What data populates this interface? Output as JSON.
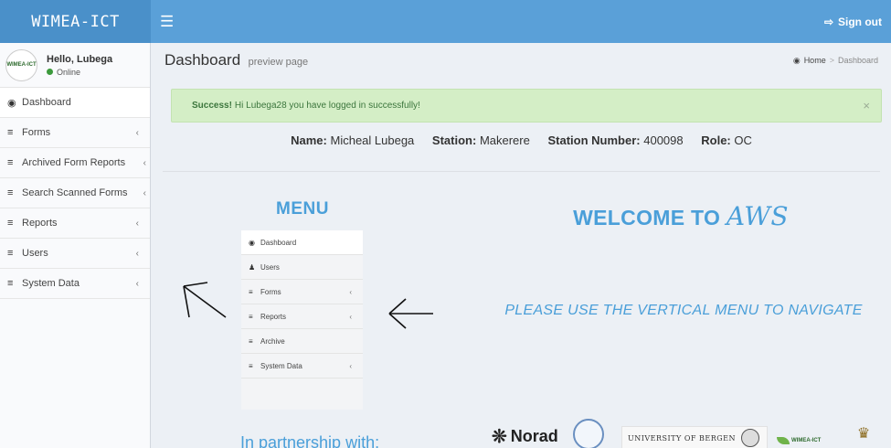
{
  "app": {
    "logo_text": "WIMEA-ICT"
  },
  "topbar": {
    "menu_icon": "hamburger-icon",
    "signout_label": "Sign out",
    "signout_icon": "sign-out-icon"
  },
  "user": {
    "greeting": "Hello, Lubega",
    "status": "Online",
    "avatar_text": "WIMEA-ICT"
  },
  "sidebar": {
    "items": [
      {
        "label": "Dashboard",
        "icon": "dashboard-icon",
        "has_submenu": false,
        "active": true
      },
      {
        "label": "Forms",
        "icon": "bars-icon",
        "has_submenu": true
      },
      {
        "label": "Archived Form Reports",
        "icon": "bars-icon",
        "has_submenu": true
      },
      {
        "label": "Search Scanned Forms",
        "icon": "bars-icon",
        "has_submenu": true
      },
      {
        "label": "Reports",
        "icon": "bars-icon",
        "has_submenu": true
      },
      {
        "label": "Users",
        "icon": "bars-icon",
        "has_submenu": true
      },
      {
        "label": "System Data",
        "icon": "bars-icon",
        "has_submenu": true
      }
    ]
  },
  "header": {
    "title": "Dashboard",
    "subtitle": "preview page",
    "breadcrumb": {
      "home": "Home",
      "separator": ">",
      "current": "Dashboard"
    }
  },
  "alert": {
    "strong": "Success!",
    "message": "Hi Lubega28 you have logged in successfully!",
    "close": "×"
  },
  "info": {
    "name_label": "Name:",
    "name_value": "Micheal Lubega",
    "station_label": "Station:",
    "station_value": "Makerere",
    "station_number_label": "Station Number:",
    "station_number_value": "400098",
    "role_label": "Role:",
    "role_value": "OC"
  },
  "demo_menu": {
    "title": "MENU",
    "items": [
      {
        "label": "Dashboard",
        "icon": "dashboard-icon",
        "has_submenu": false,
        "active": true
      },
      {
        "label": "Users",
        "icon": "user-icon",
        "has_submenu": false
      },
      {
        "label": "Forms",
        "icon": "bars-icon",
        "has_submenu": true
      },
      {
        "label": "Reports",
        "icon": "bars-icon",
        "has_submenu": true
      },
      {
        "label": "Archive",
        "icon": "bars-icon",
        "has_submenu": false
      },
      {
        "label": "System Data",
        "icon": "bars-icon",
        "has_submenu": true
      }
    ]
  },
  "welcome": {
    "prefix": "WELCOME TO",
    "script": "AWS"
  },
  "instruction": "PLEASE USE THE VERTICAL MENU TO NAVIGATE",
  "partners": {
    "heading": "In partnership with:",
    "norad": "Norad",
    "uob": "UNIVERSITY OF BERGEN",
    "wimea": "WIMEA-ICT"
  },
  "colors": {
    "topbar": "#5aa0d8",
    "logo_bg": "#4a90c9",
    "accent_text": "#4a9fd9",
    "alert_bg": "#d4eec6"
  }
}
